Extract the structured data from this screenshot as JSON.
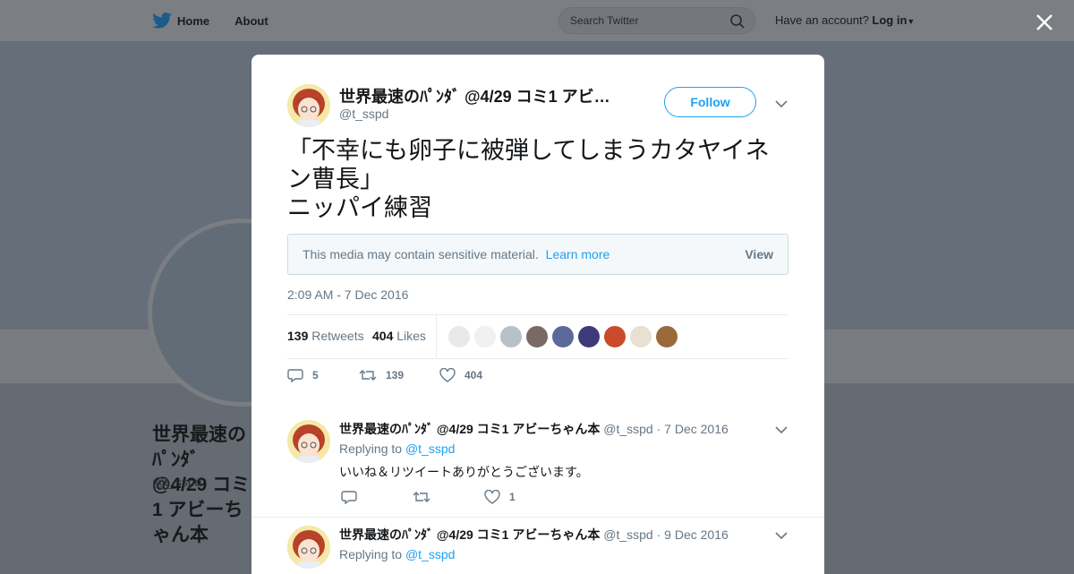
{
  "nav": {
    "home_label": "Home",
    "about_label": "About",
    "search_placeholder": "Search Twitter",
    "account_prompt": "Have an account?",
    "login_label": "Log in"
  },
  "background_profile": {
    "name": "世界最速のﾊﾟﾝﾀﾞ @4/29 コミ1 アビーちゃん本",
    "handle": "@t_sspd"
  },
  "tweet": {
    "author_name": "世界最速のﾊﾟﾝﾀﾞ @4/29 コミ1 アビーちゃん本",
    "author_handle": "@t_sspd",
    "follow_label": "Follow",
    "text": "「不幸にも卵子に被弾してしまうカタヤイネン曹長」\nニッパイ練習",
    "sensitive_notice": "This media may contain sensitive material.",
    "learn_more_label": "Learn more",
    "view_label": "View",
    "timestamp": "2:09 AM - 7 Dec 2016",
    "retweets_count": "139",
    "retweets_label": "Retweets",
    "likes_count": "404",
    "likes_label": "Likes",
    "reply_count": "5",
    "retweet_action_count": "139",
    "like_action_count": "404"
  },
  "likers": [
    {
      "color": "#e9e9e9",
      "icon": "avatar-icon"
    },
    {
      "color": "#f0f0f0",
      "icon": "avatar-icon"
    },
    {
      "color": "#b8c0c8",
      "icon": "avatar-icon"
    },
    {
      "color": "#7a6a66",
      "icon": "avatar-icon"
    },
    {
      "color": "#5b6a9a",
      "icon": "avatar-icon"
    },
    {
      "color": "#3e3a7a",
      "icon": "avatar-icon"
    },
    {
      "color": "#c94b2a",
      "icon": "avatar-icon"
    },
    {
      "color": "#e8e0d0",
      "icon": "avatar-icon"
    },
    {
      "color": "#9a6a3a",
      "icon": "avatar-icon"
    }
  ],
  "replies": [
    {
      "author_name": "世界最速のﾊﾟﾝﾀﾞ @4/29 コミ1 アビーちゃん本",
      "author_handle": "@t_sspd",
      "date": "7 Dec 2016",
      "replying_prefix": "Replying to",
      "replying_to": "@t_sspd",
      "text": "いいね＆リツイートありがとうございます。",
      "like_count": "1"
    },
    {
      "author_name": "世界最速のﾊﾟﾝﾀﾞ @4/29 コミ1 アビーちゃん本",
      "author_handle": "@t_sspd",
      "date": "9 Dec 2016",
      "replying_prefix": "Replying to",
      "replying_to": "@t_sspd"
    }
  ],
  "colors": {
    "accent": "#1da1f2",
    "overlay": "#646b72",
    "text_secondary": "#657786"
  }
}
